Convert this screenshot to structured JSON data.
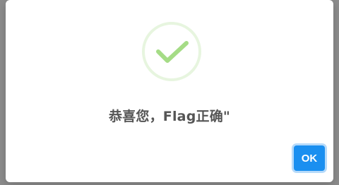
{
  "dialog": {
    "icon": "success-check-icon",
    "title": "恭喜您，Flag正确\"",
    "ok_label": "OK"
  },
  "colors": {
    "overlay": "#8c8c8c",
    "dialog_bg": "#ffffff",
    "success_ring": "#e7f5df",
    "success_check": "#a5dc86",
    "title_text": "#555555",
    "button": "#1a8ff0"
  }
}
